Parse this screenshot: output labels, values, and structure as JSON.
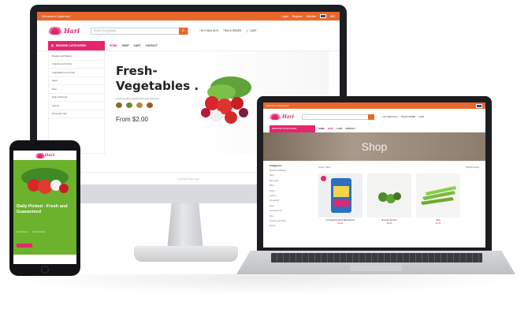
{
  "desktop": {
    "topbar": {
      "welcome": "Welcome to Supermart",
      "links": [
        "Login",
        "Register",
        "Wishlist"
      ],
      "currency": "INR"
    },
    "search_placeholder": "Search for products",
    "phone_number": "+91 9 9814 6474",
    "track_order": "TRACK ORDER",
    "cart_label": "CART",
    "category_button": "BROWSE CATEGORIES",
    "nav": [
      "HOME",
      "SHOP",
      "CART",
      "CONTACT"
    ],
    "categories": [
      "Breads and Bakery",
      "Snacks and Drinks",
      "Vegetables and Fruits",
      "Meat",
      "Rice",
      "Dairy Products",
      "Spices",
      "Personal Care"
    ],
    "hero": {
      "title_line1": "Fresh-",
      "title_line2": "Vegetables .",
      "subtitle": "Fresh produce delivered to your doorstep",
      "price": "From $2.00"
    },
    "footer": "Copyright Supermart"
  },
  "laptop": {
    "topbar": "Welcome to Supermart",
    "nav": [
      "HOME",
      "SHOP",
      "CART",
      "CONTACT"
    ],
    "category_button": "BROWSE CATEGORIES",
    "banner": "Shop",
    "sidebar_heading": "Categories",
    "sidebar_items": [
      "Breads and Bakery",
      "Dairy",
      "Beverages",
      "Dairy",
      "Fruits",
      "Grocery",
      "Household",
      "Meat",
      "Personal Care",
      "Rice",
      "Snacks and Drinks",
      "Spices"
    ],
    "sort_left": "Home / Shop",
    "sort_right": "Default sorting",
    "products": [
      {
        "name": "Sri Kerala Premium Basmati Rice",
        "price": "$3.00"
      },
      {
        "name": "Brussels Sprouts",
        "price": "$2.00"
      },
      {
        "name": "Okra",
        "price": "$1.50"
      }
    ]
  },
  "phone": {
    "hero_title": "Daily Picked - Fresh and Guaranteed",
    "meta": [
      "Free Delivery",
      "Fresh Products"
    ],
    "colors": {
      "hero": "#6cb22c",
      "accent": "#e4266e"
    }
  },
  "colors": {
    "topbar": "#e8672c",
    "brand": "#e4266e"
  }
}
